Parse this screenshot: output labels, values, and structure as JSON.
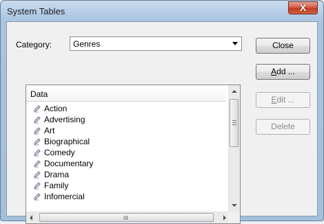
{
  "window": {
    "title": "System Tables",
    "close_glyph": "X"
  },
  "category": {
    "label": "Category:",
    "value": "Genres"
  },
  "list": {
    "header": "Data",
    "items": [
      "Action",
      "Advertising",
      "Art",
      "Biographical",
      "Comedy",
      "Documentary",
      "Drama",
      "Family",
      "Infomercial"
    ],
    "item_icon": "pencil-note-icon",
    "hscroll_grip": "III"
  },
  "buttons": {
    "close": {
      "label": "Close",
      "enabled": true
    },
    "add": {
      "accel": "A",
      "rest": "dd ...",
      "enabled": true
    },
    "edit": {
      "accel": "E",
      "rest": "dit ...",
      "enabled": false
    },
    "delete": {
      "label": "Delete",
      "enabled": false
    }
  },
  "colors": {
    "titlebar": "#b9d0e8",
    "close_button": "#c23a22",
    "client_bg": "#f0f0f0"
  }
}
